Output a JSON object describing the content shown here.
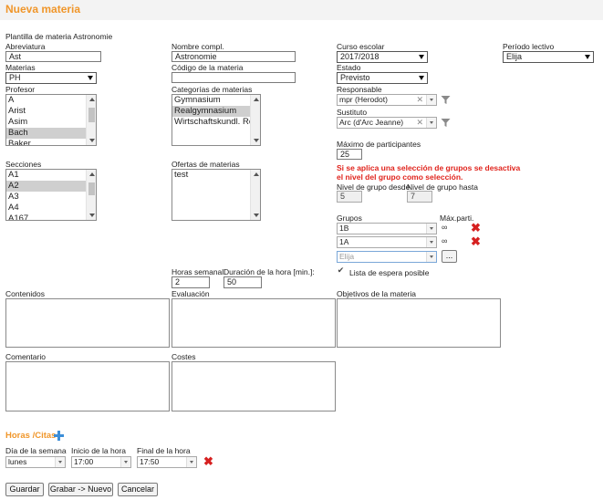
{
  "header": {
    "title": "Nueva materia"
  },
  "template_text": "Plantilla de materia Astronomie",
  "fields": {
    "abreviatura": {
      "label": "Abreviatura",
      "value": "Ast"
    },
    "nombre": {
      "label": "Nombre compl.",
      "value": "Astronomie"
    },
    "curso": {
      "label": "Curso escolar",
      "value": "2017/2018"
    },
    "periodo": {
      "label": "Período lectivo",
      "value": "Elija"
    },
    "materias": {
      "label": "Materias",
      "value": "PH"
    },
    "codigo": {
      "label": "Código de la materia",
      "value": ""
    },
    "estado": {
      "label": "Estado",
      "value": "Previsto"
    },
    "responsable": {
      "label": "Responsable",
      "value": "mpr (Herodot)"
    },
    "sustituto": {
      "label": "Sustituto",
      "value": "Arc (d'Arc Jeanne)"
    },
    "max_part": {
      "label": "Máximo de participantes",
      "value": "25"
    },
    "warning": [
      "Si se aplica una selección de grupos se desactiva",
      "el nivel del grupo como selección."
    ],
    "nivel_desde": {
      "label": "Nivel de grupo desde",
      "value": "5"
    },
    "nivel_hasta": {
      "label": "Nivel de grupo hasta",
      "value": "7"
    },
    "horas_semanal": {
      "label": "Horas semanal.",
      "value": "2"
    },
    "duracion": {
      "label": "Duración de la hora [min.]:",
      "value": "50"
    },
    "lista_espera": {
      "label": "Lista de espera posible"
    }
  },
  "profesor": {
    "label": "Profesor",
    "items": [
      "A",
      "Arist",
      "Asim",
      "Bach",
      "Baker"
    ],
    "selected": [
      3
    ]
  },
  "categorias": {
    "label": "Categorías de materias",
    "items": [
      "Gymnasium",
      "Realgymnasium",
      "Wirtschaftskundl. Rea"
    ],
    "selected": [
      1
    ]
  },
  "secciones": {
    "label": "Secciones",
    "items": [
      "A1",
      "A2",
      "A3",
      "A4",
      "A167"
    ],
    "selected": [
      1
    ]
  },
  "ofertas": {
    "label": "Ofertas de materias",
    "items": [
      "test"
    ]
  },
  "grupos": {
    "label": "Grupos",
    "max_label": "Máx.parti.",
    "rows": [
      {
        "value": "1B",
        "max": "∞"
      },
      {
        "value": "1A",
        "max": "∞"
      }
    ],
    "new_placeholder": "Elija",
    "more_label": "..."
  },
  "textareas": {
    "contenidos": "Contenidos",
    "evaluacion": "Evaluación",
    "objetivos": "Objetivos de la materia",
    "comentario": "Comentario",
    "costes": "Costes"
  },
  "horas": {
    "title": "Horas /Citas",
    "dia_label": "Día de la semana",
    "inicio_label": "Inicio de la hora",
    "final_label": "Final de la hora",
    "dia": "lunes",
    "inicio": "17:00",
    "final": "17:50"
  },
  "buttons": {
    "guardar": "Guardar",
    "grabar": "Grabar -> Nuevo",
    "cancelar": "Cancelar"
  }
}
